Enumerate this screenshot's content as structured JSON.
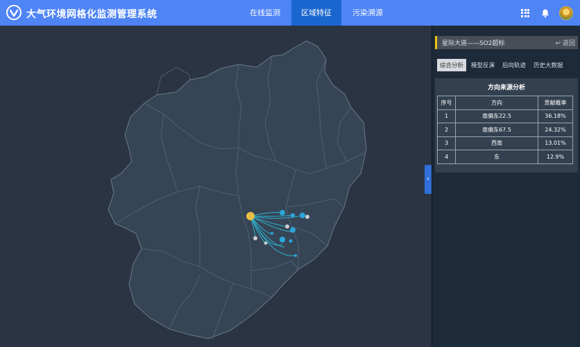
{
  "header": {
    "app_title": "大气环境网格化监测管理系统",
    "nav": [
      {
        "label": "在线监测",
        "active": false
      },
      {
        "label": "区域特征",
        "active": true
      },
      {
        "label": "污染溯源",
        "active": false
      }
    ]
  },
  "panel": {
    "title": "星际大道——SO2超标",
    "back_label": "返回",
    "tabs": [
      {
        "label": "综合分析",
        "active": true
      },
      {
        "label": "模型反演",
        "active": false
      },
      {
        "label": "后向轨迹",
        "active": false
      },
      {
        "label": "历史大数据",
        "active": false
      }
    ],
    "analysis": {
      "title": "方向来源分析",
      "columns": [
        "序号",
        "方向",
        "贡献概率"
      ],
      "rows": [
        {
          "no": "1",
          "direction": "南偏东22.5",
          "probability": "36.18%"
        },
        {
          "no": "2",
          "direction": "南偏东67.5",
          "probability": "24.32%"
        },
        {
          "no": "3",
          "direction": "西南",
          "probability": "13.01%"
        },
        {
          "no": "4",
          "direction": "东",
          "probability": "12.9%"
        }
      ]
    }
  },
  "icons": {
    "logo": "system-logo-icon",
    "apps": "grid-apps-icon",
    "notifications": "bell-icon",
    "back": "reply-arrow-icon",
    "collapse": "chevron-right-icon"
  },
  "colors": {
    "header": "#4f84f5",
    "active_tab": "#1a66cf",
    "map_bg": "#2b3442",
    "region_fill": "#364556",
    "region_border": "#5b6b7d",
    "source_point": "#e8c145",
    "receptor_point": "#2aa6d8",
    "trajectory": "#2fb6d4",
    "panel_bg": "#1d2a39",
    "title_accent": "#f1c40f"
  }
}
